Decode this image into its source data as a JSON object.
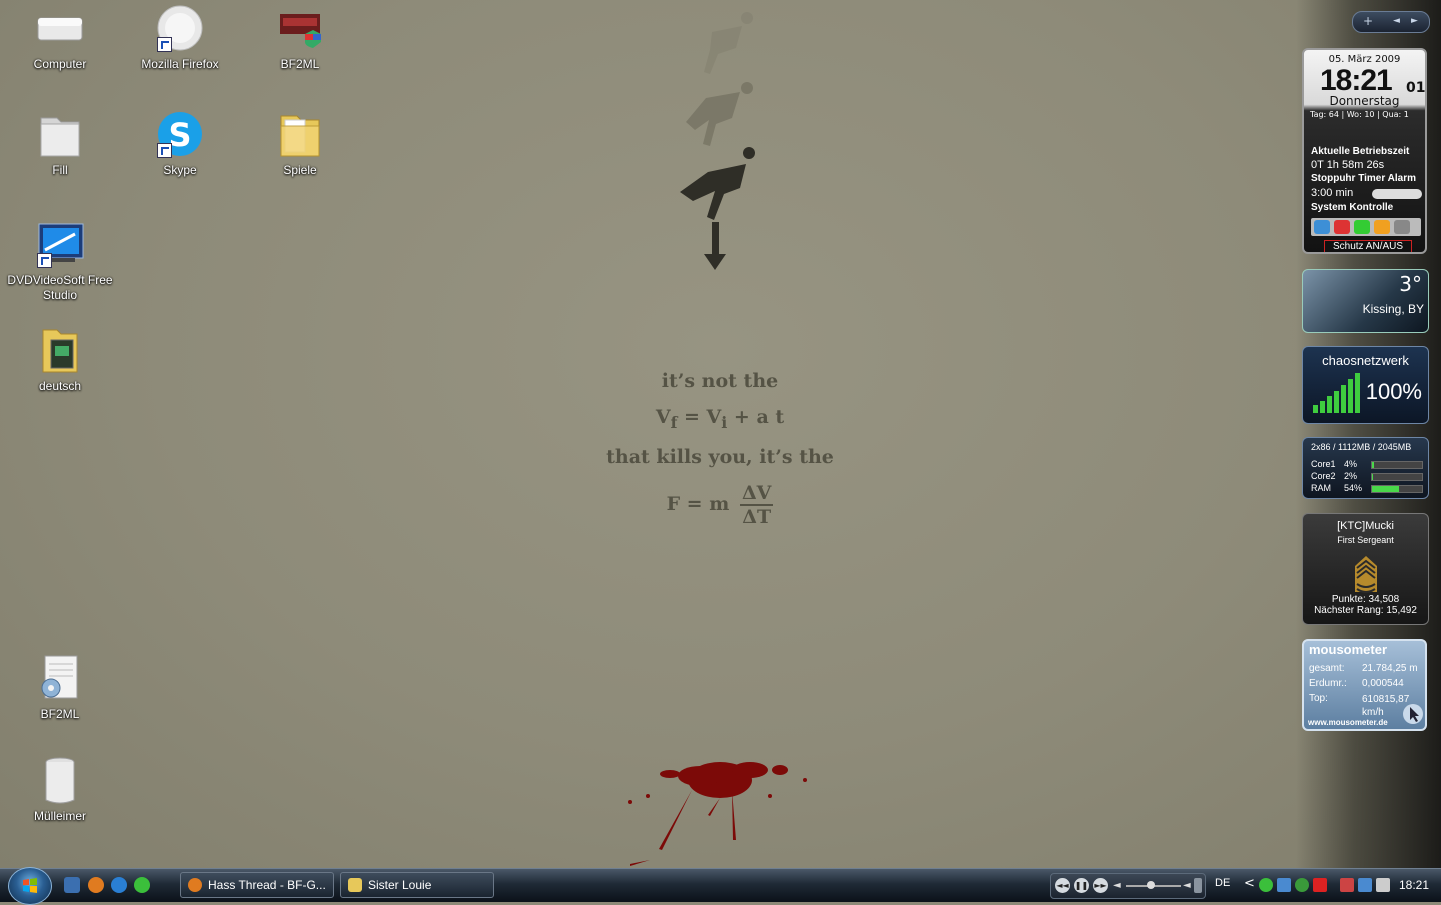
{
  "desktop": {
    "icons": [
      {
        "label": "Computer"
      },
      {
        "label": "Mozilla Firefox"
      },
      {
        "label": "BF2ML"
      },
      {
        "label": "Fill"
      },
      {
        "label": "Skype"
      },
      {
        "label": "Spiele"
      },
      {
        "label": "DVDVideoSoft Free Studio"
      },
      {
        "label": "deutsch"
      },
      {
        "label": "BF2ML"
      },
      {
        "label": "Mülleimer"
      }
    ],
    "wallpaper": {
      "line1": "it’s not the",
      "eq1_left": "V",
      "eq1_sub_f": "f",
      "eq1_mid": " = V",
      "eq1_sub_i": "i",
      "eq1_right": " + a t",
      "line2": "that kills you, it’s the",
      "eq2_left": "F = m",
      "eq2_num": "ΔV",
      "eq2_den": "ΔT",
      "accent": "#7c0a08"
    }
  },
  "sidebar": {
    "controls": {
      "add": "+",
      "prev": "◄",
      "next": "►"
    },
    "clock": {
      "date": "05. März 2009",
      "time": "18:21",
      "seconds": "01",
      "day": "Donnerstag",
      "info": "Tag: 64 | Wo: 10 | Qua: 1",
      "uptime_label": "Aktuelle Betriebszeit",
      "uptime": "0T 1h 58m 26s",
      "stopwatch_label": "Stoppuhr Timer Alarm",
      "timer": "3:00 min",
      "system_label": "System Kontrolle",
      "protection": "Schutz AN/AUS"
    },
    "weather": {
      "temp": "3°",
      "location": "Kissing, BY"
    },
    "wifi": {
      "network": "chaosnetzwerk",
      "signal": "100%"
    },
    "cpu": {
      "header": "2x86 / 1112MB / 2045MB",
      "rows": [
        {
          "name": "Core1",
          "value": "4%",
          "pct": 4
        },
        {
          "name": "Core2",
          "value": "2%",
          "pct": 2
        },
        {
          "name": "RAM",
          "value": "54%",
          "pct": 54
        }
      ]
    },
    "rank": {
      "player": "[KTC]Mucki",
      "rank": "First Sergeant",
      "points": "Punkte: 34,508",
      "next": "Nächster Rang: 15,492"
    },
    "mousometer": {
      "title": "mousometer",
      "total_label": "gesamt:",
      "total": "21.784,25 m",
      "earth_label": "Erdumr.:",
      "earth": "0,000544",
      "top_label": "Top:",
      "top": "610815,87 km/h",
      "url": "www.mousometer.de"
    }
  },
  "taskbar": {
    "tasks": [
      {
        "label": "Hass Thread - BF-G..."
      },
      {
        "label": "Sister Louie"
      }
    ],
    "language": "DE",
    "tray_chevron": "<",
    "clock": "18:21"
  }
}
